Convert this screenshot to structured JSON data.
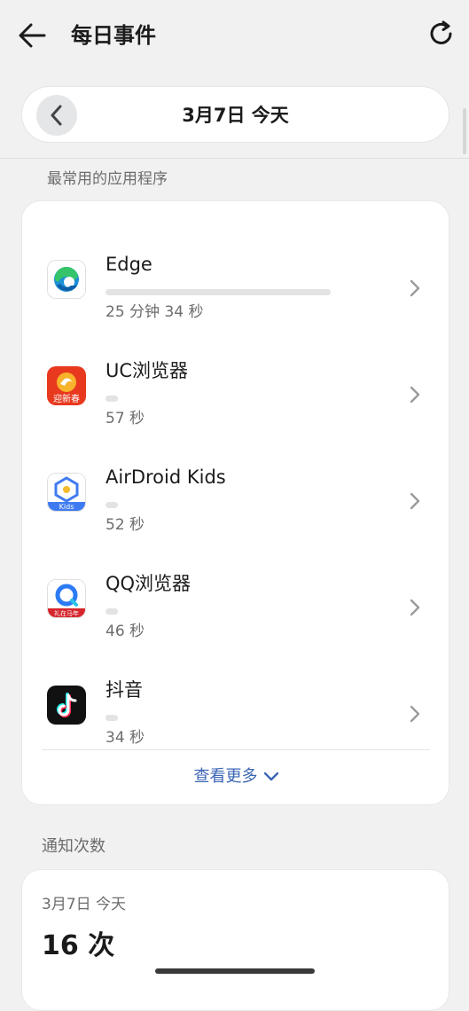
{
  "header": {
    "title": "每日事件",
    "back_icon": "arrow-left-icon",
    "refresh_icon": "refresh-icon"
  },
  "date_selector": {
    "label": "3月7日 今天",
    "prev_icon": "chevron-left-icon"
  },
  "top_apps": {
    "section_label": "最常用的应用程序",
    "apps": [
      {
        "name": "Edge",
        "time": "25 分钟 34 秒",
        "usage_fraction": 0.82,
        "icon": "edge-icon"
      },
      {
        "name": "UC浏览器",
        "time": "57 秒",
        "usage_fraction": 0.04,
        "icon": "uc-browser-icon"
      },
      {
        "name": "AirDroid Kids",
        "time": "52 秒",
        "usage_fraction": 0.035,
        "icon": "airdroid-kids-icon"
      },
      {
        "name": "QQ浏览器",
        "time": "46 秒",
        "usage_fraction": 0.03,
        "icon": "qq-browser-icon"
      },
      {
        "name": "抖音",
        "time": "34 秒",
        "usage_fraction": 0.025,
        "icon": "douyin-icon"
      }
    ],
    "see_more_label": "查看更多",
    "uc_icon_text": "迎新春",
    "airdroid_icon_text": "Kids",
    "qq_icon_text": "礼在马年"
  },
  "notifications": {
    "section_label": "通知次数",
    "date": "3月7日 今天",
    "count": "16 次"
  },
  "colors": {
    "accent": "#3b66b5",
    "background": "#f1f1f1",
    "card": "#ffffff",
    "usage_bar": "#e3e3e3"
  }
}
